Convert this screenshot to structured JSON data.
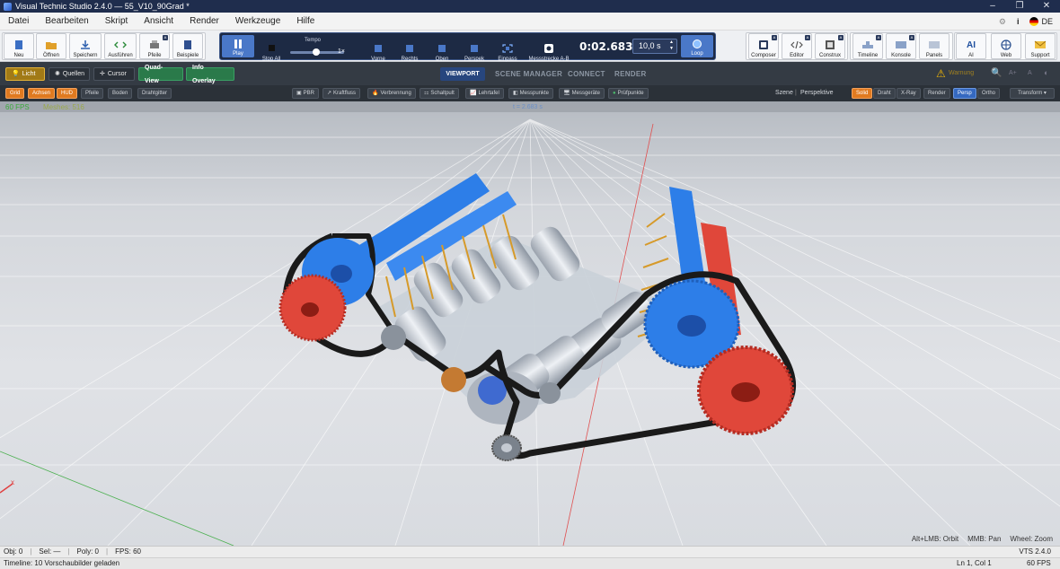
{
  "window": {
    "title": "Visual Technic Studio 2.4.0 — 55_V10_90Grad *",
    "buttons": [
      "–",
      "❐",
      "✕"
    ]
  },
  "menu": {
    "items": [
      "Datei",
      "Bearbeiten",
      "Skript",
      "Ansicht",
      "Render",
      "Werkzeuge",
      "Hilfe"
    ],
    "info_icon": "i",
    "language": "DE"
  },
  "toolbar": {
    "file_buttons": [
      "Neu",
      "Öffnen",
      "Speichern",
      "Ausführen",
      "Pfeile",
      "Beispiele"
    ],
    "transport": {
      "play": "Play",
      "stop": "Stop All",
      "tempo_label": "Tempo",
      "tempo_value": "1×",
      "views": [
        "Vorne",
        "Rechts",
        "Oben",
        "Perspek",
        "Einpass",
        "Messstrecke A-B"
      ],
      "time": "0:02.683",
      "duration": "10,0 s",
      "loop": "Loop"
    },
    "right_buttons": [
      "Composer",
      "Editor",
      "Construx",
      "Timeline",
      "Konsole",
      "Panels",
      "AI",
      "Web",
      "Support"
    ]
  },
  "modebar": {
    "left": [
      "Licht",
      "Quellen",
      "Cursor",
      "Quad-View",
      "Info Overlay"
    ],
    "tabs": [
      "VIEWPORT",
      "SCENE MANAGER",
      "CONNECT",
      "RENDER"
    ],
    "warning_text": "Warnung"
  },
  "optbar": {
    "left": [
      "Grid",
      "Achsen",
      "HUD",
      "Pfeile",
      "Boden",
      "Drahtgitter"
    ],
    "center": [
      "PBR",
      "Kraftfluss",
      "Verbrennung",
      "Schaltpult",
      "Lehrtafel",
      "Messpunkte",
      "Messgeräte",
      "Prüfpunkte"
    ],
    "scene_label": "Szene",
    "perspective_label": "Perspektive",
    "render_modes": [
      "Solid",
      "Draht",
      "X-Ray",
      "Render"
    ],
    "projection": [
      "Persp",
      "Ortho"
    ],
    "transform": "Transform ▾"
  },
  "viewport": {
    "fps": "60 FPS",
    "meshes": "Meshes: 516",
    "time_overlay": "t = 2.683 s",
    "axis_x": "x",
    "hints": [
      "Alt+LMB: Orbit",
      "MMB: Pan",
      "Wheel: Zoom"
    ]
  },
  "status": {
    "obj": "Obj: 0",
    "sel": "Sel: —",
    "poly": "Poly: 0",
    "fps": "FPS: 60",
    "version": "VTS 2.4.0",
    "message": "Timeline: 10 Vorschaubilder geladen",
    "cursor": "Ln 1, Col 1",
    "fps_right": "60 FPS"
  },
  "colors": {
    "accent": "#4a78c8",
    "orange": "#e07a20",
    "green": "#2a7a4a",
    "gear_red": "#e0473a",
    "gear_blue": "#2d7ee8",
    "belt": "#1a1a1a"
  }
}
